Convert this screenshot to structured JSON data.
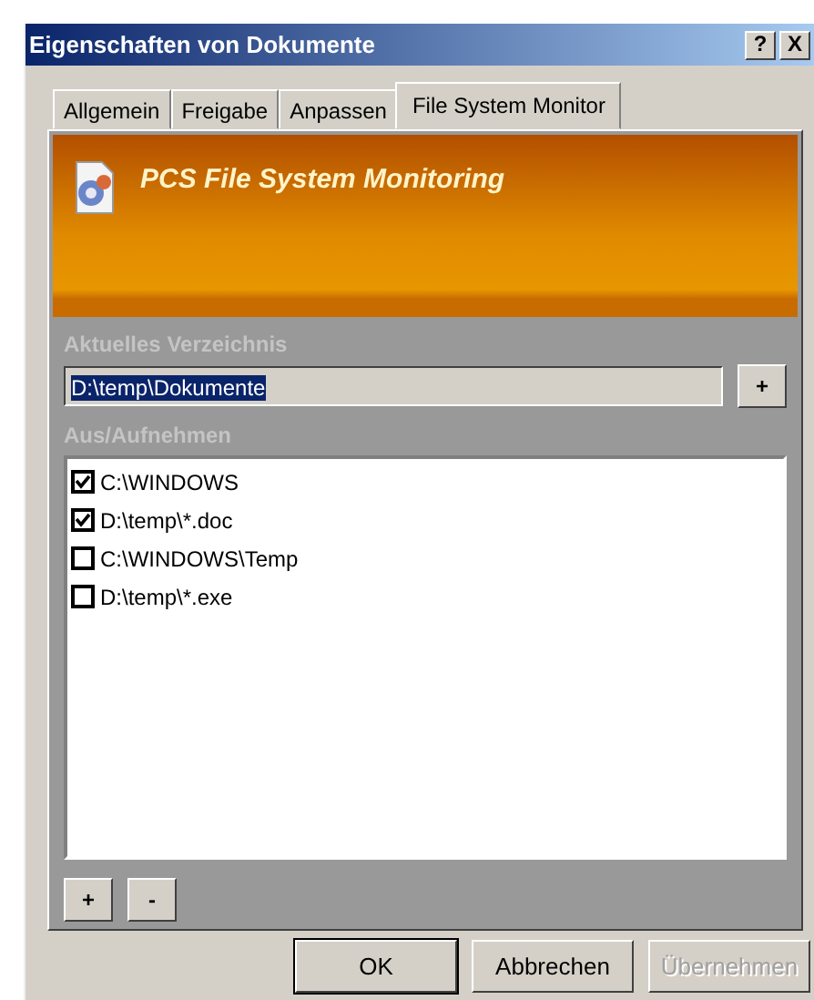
{
  "window": {
    "title": "Eigenschaften von Dokumente",
    "controls": [
      "?",
      "X"
    ]
  },
  "tabs": [
    {
      "label": "Allgemein",
      "selected": false
    },
    {
      "label": "Freigabe",
      "selected": false
    },
    {
      "label": "Anpassen",
      "selected": false
    },
    {
      "label": "File System Monitor",
      "selected": true
    }
  ],
  "header": {
    "title": "PCS File System Monitoring"
  },
  "current_directory": {
    "label": "Aktuelles Verzeichnis",
    "value": "D:\\temp\\Dokumente",
    "button": "+"
  },
  "include_exclude": {
    "label": "Aus/Aufnehmen",
    "items": [
      {
        "path": "C:\\WINDOWS",
        "checked": true
      },
      {
        "path": "D:\\temp\\*.doc",
        "checked": true
      },
      {
        "path": "C:\\WINDOWS\\Temp",
        "checked": false
      },
      {
        "path": "D:\\temp\\*.exe",
        "checked": false
      }
    ],
    "buttons": [
      "+",
      "-"
    ]
  },
  "buttons": [
    {
      "label": "OK",
      "disabled": false,
      "default": true
    },
    {
      "label": "Abbrechen",
      "disabled": false,
      "default": false
    },
    {
      "label": "Übernehmen",
      "disabled": true,
      "default": false
    }
  ]
}
